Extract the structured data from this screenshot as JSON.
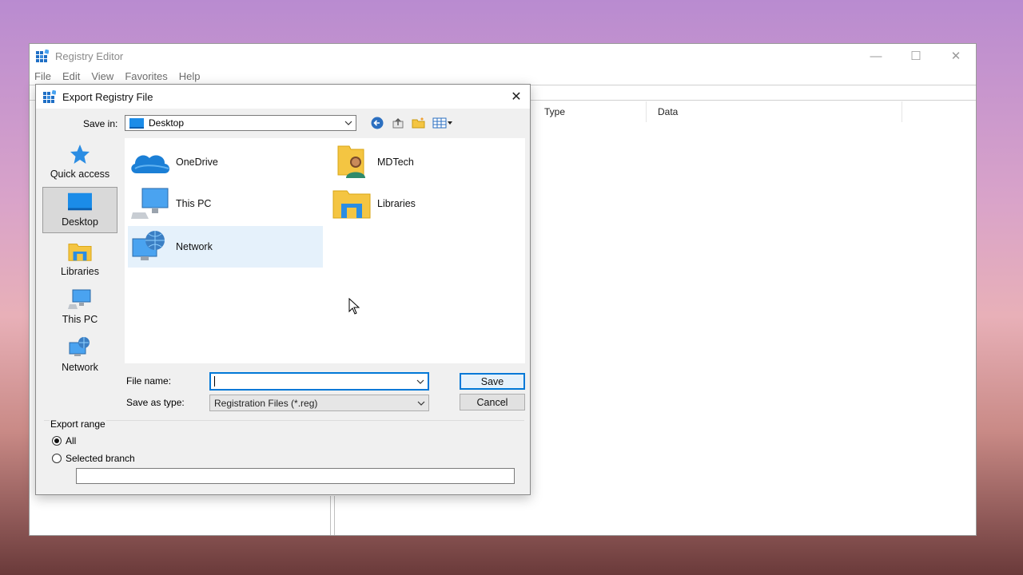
{
  "registry_window": {
    "title": "Registry Editor",
    "menu": [
      "File",
      "Edit",
      "View",
      "Favorites",
      "Help"
    ],
    "columns": [
      "Type",
      "Data"
    ],
    "controls": {
      "minimize": "—",
      "maximize": "☐",
      "close": "✕"
    }
  },
  "dialog": {
    "title": "Export Registry File",
    "close": "✕",
    "save_in_label": "Save in:",
    "save_in_value": "Desktop",
    "places": [
      {
        "label": "Quick access",
        "icon": "star-icon"
      },
      {
        "label": "Desktop",
        "icon": "desktop-icon",
        "selected": true
      },
      {
        "label": "Libraries",
        "icon": "libraries-icon"
      },
      {
        "label": "This PC",
        "icon": "computer-icon"
      },
      {
        "label": "Network",
        "icon": "network-icon"
      }
    ],
    "items": [
      {
        "label": "OneDrive",
        "icon": "onedrive-icon"
      },
      {
        "label": "MDTech",
        "icon": "user-folder-icon"
      },
      {
        "label": "This PC",
        "icon": "computer-icon"
      },
      {
        "label": "Libraries",
        "icon": "libraries-icon"
      },
      {
        "label": "Network",
        "icon": "network-icon",
        "hover": true
      }
    ],
    "file_name_label": "File name:",
    "file_name_value": "",
    "save_as_type_label": "Save as type:",
    "save_as_type_value": "Registration Files (*.reg)",
    "save_button": "Save",
    "cancel_button": "Cancel",
    "export_range": {
      "label": "Export range",
      "all": "All",
      "selected_branch": "Selected branch",
      "branch_value": "",
      "selected": "all"
    },
    "colors": {
      "accent": "#0078d7",
      "hover": "#e5f1fb"
    }
  }
}
